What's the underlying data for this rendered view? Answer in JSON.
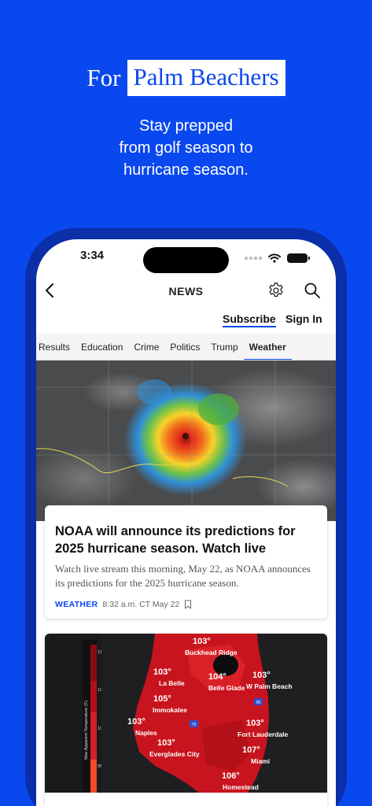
{
  "promo": {
    "title_prefix": "For",
    "title_highlight": "Palm Beachers",
    "subtitle_line1": "Stay prepped",
    "subtitle_line2": "from golf season to",
    "subtitle_line3": "hurricane season."
  },
  "status_bar": {
    "time": "3:34"
  },
  "nav": {
    "title": "NEWS",
    "subscribe": "Subscribe",
    "sign_in": "Sign In"
  },
  "tabs": [
    {
      "label": "Results",
      "active": false
    },
    {
      "label": "Education",
      "active": false
    },
    {
      "label": "Crime",
      "active": false
    },
    {
      "label": "Politics",
      "active": false
    },
    {
      "label": "Trump",
      "active": false
    },
    {
      "label": "Weather",
      "active": true
    }
  ],
  "article": {
    "title": "NOAA will announce its predictions for 2025 hurricane season. Watch live",
    "description": "Watch live stream this morning, May 22, as NOAA announces its predictions for the 2025 hurricane season.",
    "tag": "WEATHER",
    "timestamp": "8:32 a.m. CT May 22"
  },
  "map": {
    "legend_label": "Max Apparent Temperature (F)",
    "legend_ticks": [
      "110°",
      "105°",
      "100°",
      "95°"
    ],
    "cities": [
      {
        "temp": "103°",
        "name": "Buckhead Ridge"
      },
      {
        "temp": "103°",
        "name": "La Belle"
      },
      {
        "temp": "104°",
        "name": "Belle Glade"
      },
      {
        "temp": "103°",
        "name": "W Palm Beach"
      },
      {
        "temp": "105°",
        "name": "Immokalee"
      },
      {
        "temp": "103°",
        "name": "Naples"
      },
      {
        "temp": "103°",
        "name": "Everglades City"
      },
      {
        "temp": "103°",
        "name": "Fort Lauderdale"
      },
      {
        "temp": "107°",
        "name": "Miami"
      },
      {
        "temp": "106°",
        "name": "Homestead"
      }
    ],
    "highway_shields": [
      "75",
      "95"
    ]
  },
  "colors": {
    "brand_blue": "#0a48ef",
    "heat_red": "#c8141e"
  }
}
